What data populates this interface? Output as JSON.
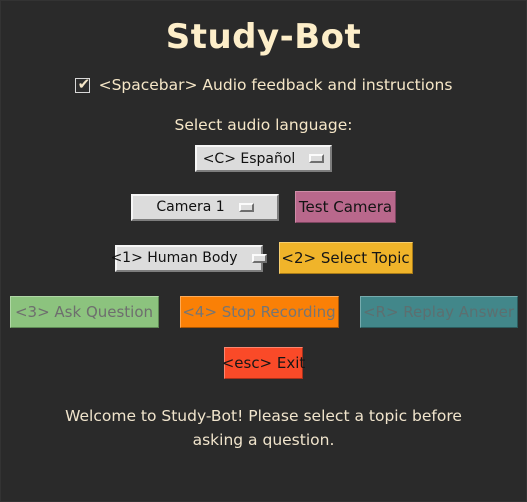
{
  "window": {
    "title": "Study-Bot",
    "background": "#2a2a2a"
  },
  "header": {
    "title": "Study-Bot",
    "title_color": "#fdeec9"
  },
  "audio_feedback": {
    "label": "<Spacebar> Audio feedback and instructions",
    "checked": true,
    "check_glyph": "✔"
  },
  "language": {
    "section_label": "Select audio language:",
    "selected": "<C> Español",
    "options": [
      "<C> Español"
    ]
  },
  "camera": {
    "selected": "Camera 1",
    "options": [
      "Camera 1"
    ],
    "test_button": {
      "label": "Test Camera",
      "color": "#b9688c",
      "enabled": true
    }
  },
  "topic": {
    "selected": "<1> Human Body",
    "options": [
      "<1> Human Body"
    ],
    "select_button": {
      "label": "<2> Select Topic",
      "color": "#f0b42a",
      "enabled": true
    }
  },
  "actions": [
    {
      "name": "ask-question",
      "label": "<3> Ask Question",
      "color": "#8cc37e",
      "text_color": "#6e6e6e",
      "enabled": false
    },
    {
      "name": "stop-recording",
      "label": "<4> Stop Recording",
      "color": "#fa8006",
      "text_color": "#757575",
      "enabled": false
    },
    {
      "name": "replay-answer",
      "label": "<R> Replay Answer",
      "color": "#42878a",
      "text_color": "#5c6f70",
      "enabled": false
    }
  ],
  "exit": {
    "label": "<esc> Exit",
    "color": "#fa4a28",
    "enabled": true
  },
  "status": {
    "message": "Welcome to Study-Bot! Please select a topic before asking a question."
  }
}
